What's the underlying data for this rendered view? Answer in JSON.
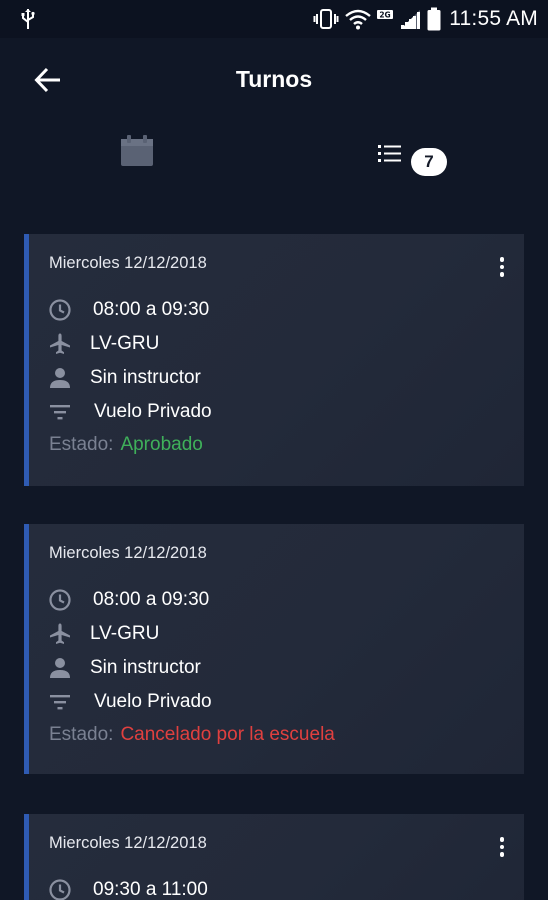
{
  "status_bar": {
    "time": "11:55 AM",
    "icons": [
      "usb-icon",
      "vibrate-icon",
      "wifi-icon",
      "lte-icon",
      "signal-icon",
      "battery-icon"
    ]
  },
  "app_bar": {
    "title": "Turnos",
    "back_icon": "arrow-left-icon"
  },
  "tabs": {
    "calendar_icon": "calendar-icon",
    "list_icon": "list-icon",
    "list_count": "7"
  },
  "colors": {
    "background": "#101726",
    "card": "#242b3b",
    "accent": "#2f5bb3",
    "approved": "#3fb05a",
    "cancelled": "#e0403f"
  },
  "turnos": [
    {
      "date": "Miercoles 12/12/2018",
      "time": "08:00 a 09:30",
      "aircraft": "LV-GRU",
      "instructor": "Sin instructor",
      "type": "Vuelo Privado",
      "status_label": "Estado:",
      "status": "Aprobado"
    },
    {
      "date": "Miercoles 12/12/2018",
      "time": "08:00 a 09:30",
      "aircraft": "LV-GRU",
      "instructor": "Sin instructor",
      "type": "Vuelo Privado",
      "status_label": "Estado:",
      "status": "Cancelado por la escuela"
    },
    {
      "date": "Miercoles 12/12/2018",
      "time": "09:30 a 11:00"
    }
  ]
}
